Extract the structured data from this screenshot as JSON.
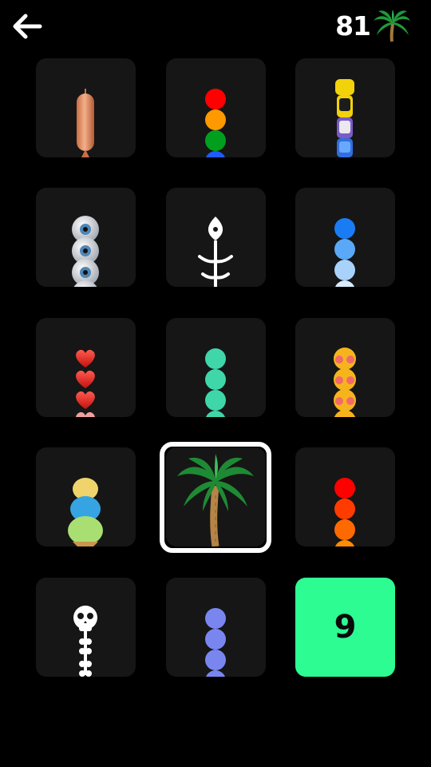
{
  "header": {
    "score": "81",
    "back_icon": "back-arrow-icon",
    "currency_icon": "palm-tree-icon"
  },
  "skins": [
    {
      "id": "sausage",
      "icon": "sausage-icon"
    },
    {
      "id": "traffic-light",
      "icon": "traffic-balls-icon",
      "colors": [
        "#ff0000",
        "#ff9900",
        "#00a01e",
        "#1f5bff"
      ]
    },
    {
      "id": "cars",
      "icon": "car-stack-icon"
    },
    {
      "id": "eyeballs",
      "icon": "eyeball-stack-icon"
    },
    {
      "id": "fish-bone",
      "icon": "fish-skeleton-icon"
    },
    {
      "id": "blue-balls",
      "icon": "blue-balls-icon",
      "colors": [
        "#1a7cf5",
        "#5aa8f7",
        "#a8d2fa",
        "#d8ecfd"
      ]
    },
    {
      "id": "hearts",
      "icon": "heart-stack-icon"
    },
    {
      "id": "teal-balls",
      "icon": "teal-balls-icon",
      "colors": [
        "#3fd6aa",
        "#3fd6aa",
        "#3fd6aa",
        "#3fd6aa"
      ]
    },
    {
      "id": "emoji-faces",
      "icon": "emoji-stack-icon"
    },
    {
      "id": "ice-cream",
      "icon": "ice-cream-icon"
    },
    {
      "id": "palm-tree",
      "icon": "palm-tree-icon",
      "selected": true
    },
    {
      "id": "fire-balls",
      "icon": "red-orange-balls-icon",
      "colors": [
        "#ff0000",
        "#ff3b00",
        "#ff6a00",
        "#ff8c00"
      ]
    },
    {
      "id": "skeleton",
      "icon": "skeleton-icon"
    },
    {
      "id": "lavender-balls",
      "icon": "lavender-balls-icon",
      "colors": [
        "#7a86f0",
        "#7a86f0",
        "#7a86f0",
        "#7a86f0"
      ]
    },
    {
      "id": "locked",
      "icon": "",
      "price": "9"
    }
  ],
  "colors": {
    "tile_bg": "#161616",
    "locked_tile_bg": "#2dfc93",
    "selection_border": "#ffffff"
  }
}
